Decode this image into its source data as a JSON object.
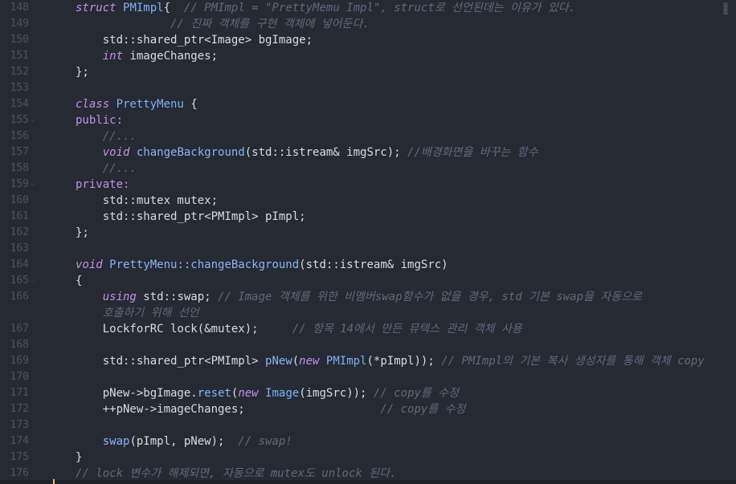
{
  "editor": {
    "lines": [
      {
        "no": "148",
        "parts": [
          {
            "t": "struct ",
            "c": "kw"
          },
          {
            "t": "PMImpl",
            "c": "ty"
          },
          {
            "t": "{  ",
            "c": "op"
          },
          {
            "t": "// PMImpl = \"PrettyMemu Impl\", struct로 선언된데는 이유가 있다.",
            "c": "cm"
          }
        ]
      },
      {
        "no": "149",
        "parts": [
          {
            "t": "              // 진짜 객체를 구현 객체에 넣어둔다.",
            "c": "cm"
          }
        ]
      },
      {
        "no": "150",
        "parts": [
          {
            "t": "    std::shared_ptr<Image> bgImage;",
            "c": "op"
          }
        ]
      },
      {
        "no": "151",
        "parts": [
          {
            "t": "    ",
            "c": "op"
          },
          {
            "t": "int",
            "c": "kw"
          },
          {
            "t": " imageChanges;",
            "c": "op"
          }
        ]
      },
      {
        "no": "152",
        "parts": [
          {
            "t": "};",
            "c": "op"
          }
        ]
      },
      {
        "no": "153",
        "parts": []
      },
      {
        "no": "154",
        "parts": [
          {
            "t": "class ",
            "c": "kw"
          },
          {
            "t": "PrettyMenu",
            "c": "ty"
          },
          {
            "t": " {",
            "c": "op"
          }
        ]
      },
      {
        "no": "155",
        "fold": true,
        "parts": [
          {
            "t": "public:",
            "c": "kw2"
          }
        ]
      },
      {
        "no": "156",
        "parts": [
          {
            "t": "    //...",
            "c": "cm"
          }
        ]
      },
      {
        "no": "157",
        "parts": [
          {
            "t": "    ",
            "c": "op"
          },
          {
            "t": "void",
            "c": "kw"
          },
          {
            "t": " ",
            "c": "op"
          },
          {
            "t": "changeBackground",
            "c": "fn"
          },
          {
            "t": "(std::istream& imgSrc); ",
            "c": "op"
          },
          {
            "t": "//배경화면을 바꾸는 함수",
            "c": "cm"
          }
        ]
      },
      {
        "no": "158",
        "parts": [
          {
            "t": "    //...",
            "c": "cm"
          }
        ]
      },
      {
        "no": "159",
        "fold": true,
        "parts": [
          {
            "t": "private:",
            "c": "kw2"
          }
        ]
      },
      {
        "no": "160",
        "parts": [
          {
            "t": "    std::mutex mutex;",
            "c": "op"
          }
        ]
      },
      {
        "no": "161",
        "parts": [
          {
            "t": "    std::shared_ptr<PMImpl> pImpl;",
            "c": "op"
          }
        ]
      },
      {
        "no": "162",
        "parts": [
          {
            "t": "};",
            "c": "op"
          }
        ]
      },
      {
        "no": "163",
        "parts": []
      },
      {
        "no": "164",
        "parts": [
          {
            "t": "void ",
            "c": "kw"
          },
          {
            "t": "PrettyMenu::changeBackground",
            "c": "fn"
          },
          {
            "t": "(std::istream& imgSrc)",
            "c": "op"
          }
        ]
      },
      {
        "no": "165",
        "fold": true,
        "parts": [
          {
            "t": "{",
            "c": "op"
          }
        ]
      },
      {
        "no": "166",
        "parts": [
          {
            "t": "    ",
            "c": "op"
          },
          {
            "t": "using",
            "c": "kw"
          },
          {
            "t": " std::swap; ",
            "c": "op"
          },
          {
            "t": "// Image 객체를 위한 비멤버swap함수가 없을 경우, std 기본 swap을 자동으로",
            "c": "cm"
          }
        ]
      },
      {
        "no": "",
        "parts": [
          {
            "t": "    호출하기 위해 선언",
            "c": "cm"
          }
        ]
      },
      {
        "no": "167",
        "parts": [
          {
            "t": "    LockforRC lock(&mutex);     ",
            "c": "op"
          },
          {
            "t": "// 항목 14에서 만든 뮤텍스 관리 객체 사용",
            "c": "cm"
          }
        ]
      },
      {
        "no": "168",
        "parts": []
      },
      {
        "no": "169",
        "parts": [
          {
            "t": "    std::shared_ptr<PMImpl> ",
            "c": "op"
          },
          {
            "t": "pNew",
            "c": "fn"
          },
          {
            "t": "(",
            "c": "op"
          },
          {
            "t": "new",
            "c": "kw"
          },
          {
            "t": " ",
            "c": "op"
          },
          {
            "t": "PMImpl",
            "c": "ty"
          },
          {
            "t": "(*pImpl)); ",
            "c": "op"
          },
          {
            "t": "// PMImpl의 기본 복사 생성자를 통해 객체 copy",
            "c": "cm"
          }
        ]
      },
      {
        "no": "170",
        "parts": []
      },
      {
        "no": "171",
        "parts": [
          {
            "t": "    pNew->bgImage.",
            "c": "op"
          },
          {
            "t": "reset",
            "c": "fn"
          },
          {
            "t": "(",
            "c": "op"
          },
          {
            "t": "new",
            "c": "kw"
          },
          {
            "t": " ",
            "c": "op"
          },
          {
            "t": "Image",
            "c": "ty"
          },
          {
            "t": "(imgSrc)); ",
            "c": "op"
          },
          {
            "t": "// copy를 수정",
            "c": "cm"
          }
        ]
      },
      {
        "no": "172",
        "parts": [
          {
            "t": "    ++pNew->imageChanges;                    ",
            "c": "op"
          },
          {
            "t": "// copy를 수정",
            "c": "cm"
          }
        ]
      },
      {
        "no": "173",
        "parts": []
      },
      {
        "no": "174",
        "parts": [
          {
            "t": "    ",
            "c": "op"
          },
          {
            "t": "swap",
            "c": "fn"
          },
          {
            "t": "(pImpl, pNew);  ",
            "c": "op"
          },
          {
            "t": "// swap!",
            "c": "cm"
          }
        ]
      },
      {
        "no": "175",
        "parts": [
          {
            "t": "}",
            "c": "op"
          }
        ]
      },
      {
        "no": "176",
        "parts": [
          {
            "t": "// lock 변수가 해제되면, 자동으로 mutex도 unlock 된다.",
            "c": "cm"
          }
        ]
      }
    ]
  }
}
